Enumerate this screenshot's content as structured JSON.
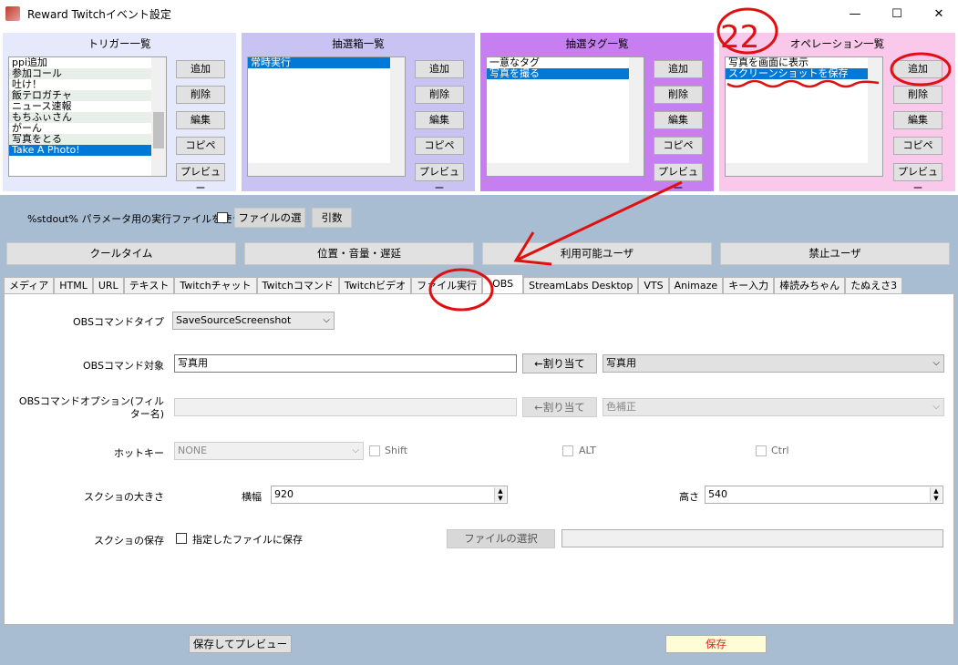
{
  "window": {
    "title": "Reward Twitchイベント設定",
    "minimize": "—",
    "maximize": "☐",
    "close": "✕"
  },
  "panels": {
    "trigger": {
      "title": "トリガー一覧",
      "items": [
        "ppi追加",
        "参加コール",
        "吐け！",
        "飯テロガチャ",
        "ニュース速報",
        "もちふぃさん",
        "がーん",
        "写真をとる",
        "Take A Photo!"
      ],
      "selected": 8
    },
    "lottery": {
      "title": "抽選箱一覧",
      "items": [
        "常時実行"
      ],
      "selected": 0
    },
    "tags": {
      "title": "抽選タグ一覧",
      "items": [
        "一意なタグ",
        "写真を撮る"
      ],
      "selected": 1
    },
    "ops": {
      "title": "オペレーション一覧",
      "items": [
        "写真を画面に表示",
        "スクリーンショットを保存"
      ],
      "selected": 1
    },
    "buttons": {
      "add": "追加",
      "delete": "削除",
      "edit": "編集",
      "copy": "コピペ",
      "preview": "プレビュー"
    }
  },
  "stdout": {
    "label": "%stdout% パラメータ用の実行ファイルを使う",
    "file_button": "ファイルの選",
    "args_button": "引数"
  },
  "actions": {
    "cooltime": "クールタイム",
    "position": "位置・音量・遅延",
    "users": "利用可能ユーザ",
    "banned": "禁止ユーザ"
  },
  "tabs": [
    "メディア",
    "HTML",
    "URL",
    "テキスト",
    "Twitchチャット",
    "Twitchコマンド",
    "Twitchビデオ",
    "ファイル実行",
    "OBS",
    "StreamLabs Desktop",
    "VTS",
    "Animaze",
    "キー入力",
    "棒読みちゃん",
    "たぬえさ3"
  ],
  "active_tab": 8,
  "form": {
    "cmd_type_label": "OBSコマンドタイプ",
    "cmd_type_value": "SaveSourceScreenshot",
    "target_label": "OBSコマンド対象",
    "target_value": "写真用",
    "assign_label": "←割り当て",
    "target_select": "写真用",
    "option_label": "OBSコマンドオプション(フィルター名)",
    "option_value": "",
    "option_select": "色補正",
    "hotkey_label": "ホットキー",
    "hotkey_value": "NONE",
    "shift": "Shift",
    "alt": "ALT",
    "ctrl": "Ctrl",
    "size_label": "スクショの大きさ",
    "width_label": "横幅",
    "width_value": "920",
    "height_label": "高さ",
    "height_value": "540",
    "save_label": "スクショの保存",
    "save_check": "指定したファイルに保存",
    "file_select": "ファイルの選択",
    "file_path": ""
  },
  "bottom": {
    "save_preview": "保存してプレビュー",
    "save": "保存"
  },
  "annotation": {
    "number": "22"
  },
  "colors": {
    "trigger_bg": "#e6e9fb",
    "lottery_bg": "#c9c3f4",
    "tags_bg": "#c77ef1",
    "ops_bg": "#f9c8ea",
    "body_bg": "#a9bdd2",
    "annotation": "#e01010",
    "selection": "#0078d7"
  }
}
